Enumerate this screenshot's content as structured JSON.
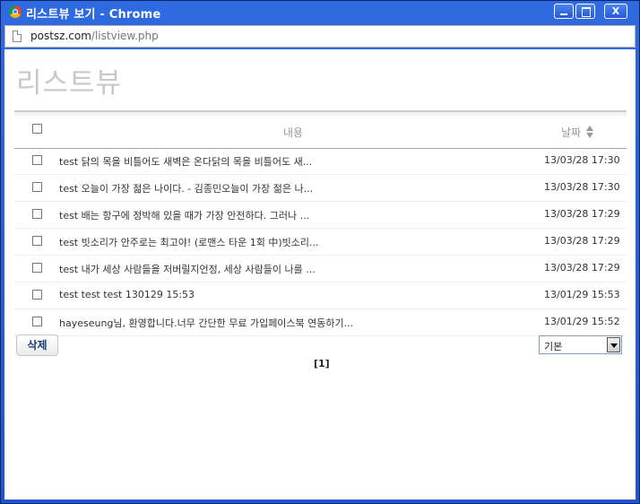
{
  "window": {
    "title": "리스트뷰 보기 - Chrome",
    "minimize_label": "_",
    "maximize_label": "□",
    "close_label": "X"
  },
  "address_bar": {
    "host": "postsz.com",
    "path": "/listview.php"
  },
  "page": {
    "title": "리스트뷰"
  },
  "table": {
    "headers": {
      "content": "내용",
      "date": "날짜"
    },
    "rows": [
      {
        "title": "test 닭의 목을 비틀어도 새벽은 온다닭의 목을 비틀어도 새...",
        "date": "13/03/28 17:30"
      },
      {
        "title": "test 오늘이 가장 젊은 나이다. - 김종민오늘이 가장 젊은 나...",
        "date": "13/03/28 17:30"
      },
      {
        "title": "test 배는 항구에 정박해 있을 때가 가장 안전하다. 그러나 ...",
        "date": "13/03/28 17:29"
      },
      {
        "title": "test 빗소리가 안주로는 최고야! (로맨스 타운 1회 中)빗소리...",
        "date": "13/03/28 17:29"
      },
      {
        "title": "test 내가 세상 사람들을 저버릴지언정, 세상 사람들이 나를 ...",
        "date": "13/03/28 17:29"
      },
      {
        "title": "test test test 130129 15:53",
        "date": "13/01/29 15:53"
      },
      {
        "title": "hayeseung님, 환영합니다.너무 간단한 무료 가입페이스북 연동하기...",
        "date": "13/01/29 15:52"
      }
    ]
  },
  "actions": {
    "delete_label": "삭제",
    "sort_select_value": "기본"
  },
  "pagination": {
    "current": "[1]"
  },
  "icons": {
    "app": "chrome-icon",
    "page": "page-icon",
    "sort": "sort-arrows-icon",
    "dropdown": "chevron-down-icon"
  },
  "colors": {
    "titlebar": "#2f6ae0",
    "page_title": "#c8c8c8",
    "delete_text": "#1a3a7a"
  }
}
